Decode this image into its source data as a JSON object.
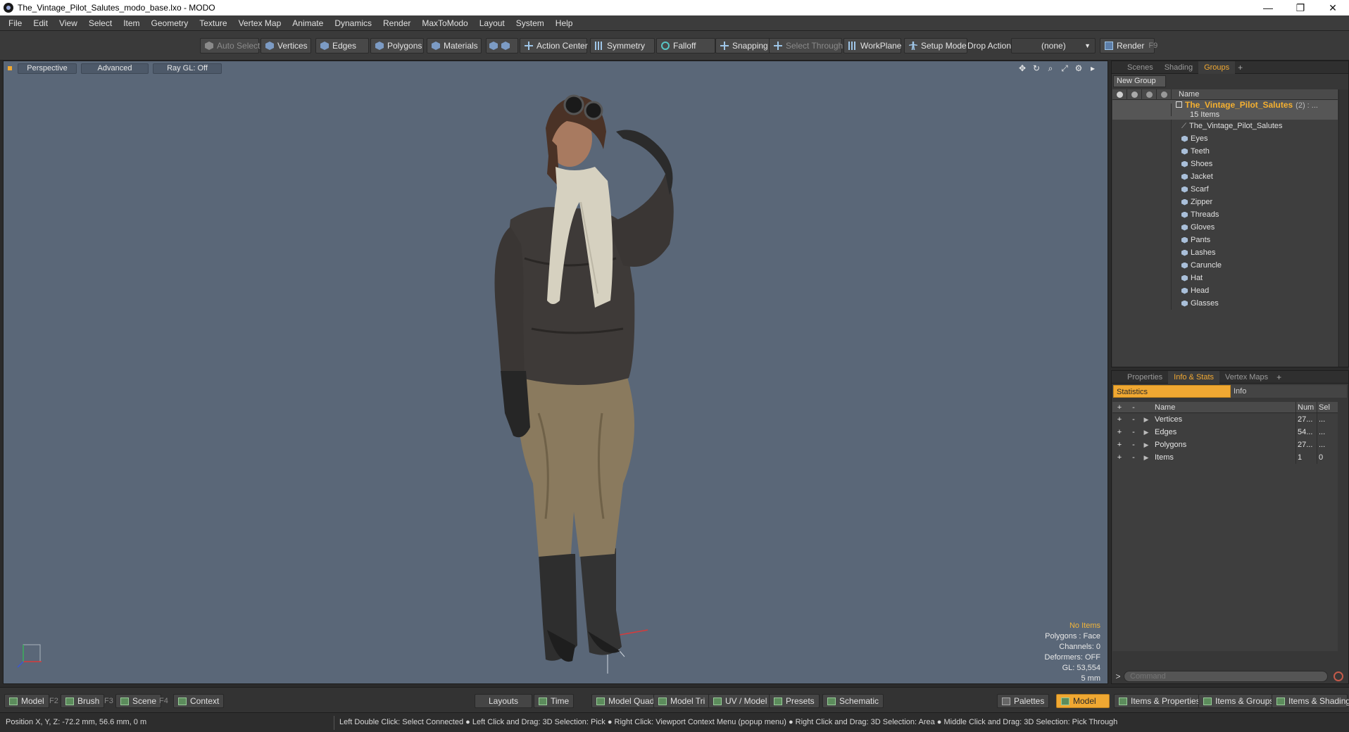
{
  "window": {
    "title": "The_Vintage_Pilot_Salutes_modo_base.lxo - MODO",
    "minimize": "—",
    "restore": "❐",
    "close": "✕"
  },
  "menu": [
    "File",
    "Edit",
    "View",
    "Select",
    "Item",
    "Geometry",
    "Texture",
    "Vertex Map",
    "Animate",
    "Dynamics",
    "Render",
    "MaxToModo",
    "Layout",
    "System",
    "Help"
  ],
  "toolbar": {
    "auto_select": "Auto Select",
    "vertices": "Vertices",
    "edges": "Edges",
    "polygons": "Polygons",
    "materials": "Materials",
    "action_center": "Action Center",
    "symmetry": "Symmetry",
    "falloff": "Falloff",
    "snapping": "Snapping",
    "select_through": "Select Through",
    "workplane": "WorkPlane",
    "setup_mode": "Setup Mode",
    "drop_action": "Drop Action",
    "drop_value": "(none)",
    "render": "Render",
    "render_key": "F9"
  },
  "viewport": {
    "perspective": "Perspective",
    "advanced": "Advanced",
    "raygl": "Ray GL: Off",
    "info": {
      "items": "No Items",
      "polygons": "Polygons : Face",
      "channels": "Channels: 0",
      "deformers": "Deformers: OFF",
      "gl": "GL: 53,554",
      "scale": "5 mm"
    }
  },
  "groups_panel": {
    "tabs": [
      "Scenes",
      "Shading",
      "Groups"
    ],
    "active_tab": "Groups",
    "new_group": "New Group",
    "col_name": "Name",
    "root": {
      "name": "The_Vintage_Pilot_Salutes",
      "count": "(2) : ...",
      "sub": "15 Items"
    },
    "items": [
      "The_Vintage_Pilot_Salutes",
      "Eyes",
      "Teeth",
      "Shoes",
      "Jacket",
      "Scarf",
      "Zipper",
      "Threads",
      "Gloves",
      "Pants",
      "Lashes",
      "Caruncle",
      "Hat",
      "Head",
      "Glasses"
    ]
  },
  "stats_panel": {
    "tabs": [
      "Properties",
      "Info & Stats",
      "Vertex Maps"
    ],
    "active_tab": "Info & Stats",
    "sub_tabs": [
      "Statistics",
      "Info"
    ],
    "head": {
      "plus": "+",
      "minus": "-",
      "name": "Name",
      "num": "Num",
      "sel": "Sel"
    },
    "rows": [
      {
        "name": "Vertices",
        "num": "27...",
        "sel": "..."
      },
      {
        "name": "Edges",
        "num": "54...",
        "sel": "..."
      },
      {
        "name": "Polygons",
        "num": "27...",
        "sel": "..."
      },
      {
        "name": "Items",
        "num": "1",
        "sel": "0"
      }
    ],
    "command_placeholder": "Command"
  },
  "bottom": {
    "model": "Model",
    "f2": "F2",
    "brush": "Brush",
    "f3": "F3",
    "scene": "Scene",
    "f4": "F4",
    "context": "Context",
    "layouts": "Layouts",
    "time": "Time",
    "model_quad": "Model Quad",
    "model_tri": "Model Tri",
    "uv_model": "UV / Model",
    "presets": "Presets",
    "schematic": "Schematic",
    "palettes": "Palettes",
    "model_active": "Model",
    "items_props": "Items & Properties",
    "items_groups": "Items & Groups",
    "items_shading": "Items & Shading"
  },
  "status": {
    "position": "Position X, Y, Z:   -72.2 mm, 56.6 mm, 0 m",
    "hint": "Left Double Click: Select Connected ● Left Click and Drag: 3D Selection: Pick ● Right Click: Viewport Context Menu (popup menu) ● Right Click and Drag: 3D Selection: Area ● Middle Click and Drag: 3D Selection: Pick Through"
  }
}
